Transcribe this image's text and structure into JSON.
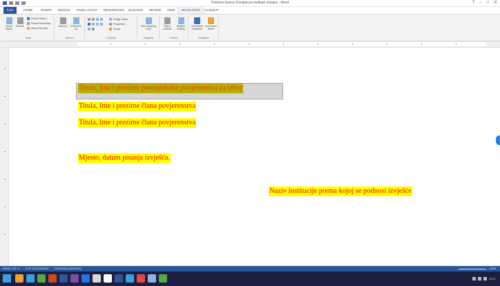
{
  "window": {
    "title": "Podnosi Surina Templat po molbani selspra - Word",
    "controls": [
      "?",
      "–",
      "□",
      "✕"
    ]
  },
  "tabs": [
    {
      "label": "FILE"
    },
    {
      "label": "HOME"
    },
    {
      "label": "INSERT"
    },
    {
      "label": "DESIGN"
    },
    {
      "label": "PAGE LAYOUT"
    },
    {
      "label": "REFERENCES"
    },
    {
      "label": "MAILINGS"
    },
    {
      "label": "REVIEW"
    },
    {
      "label": "VIEW"
    },
    {
      "label": "DEVELOPER"
    },
    {
      "label": "Acrobat Pl"
    }
  ],
  "ribbon": {
    "code": {
      "label": "Code",
      "visual_basic": "Visual Basic",
      "macros": "Macros",
      "record_macro": "Record Macro",
      "pause_recording": "Pause Recording",
      "macro_security": "Macro Security"
    },
    "addins": {
      "label": "Add-Ins",
      "add_ins": "Add-Ins",
      "com_add_ins": "COM Add-Ins"
    },
    "controls": {
      "label": "Controls",
      "design_mode": "Design Mode",
      "properties": "Properties",
      "group": "Group"
    },
    "mapping": {
      "label": "Mapping",
      "xml_mapping": "XML Mapping Pane"
    },
    "protect": {
      "label": "Protect",
      "block_authors": "Block Authors",
      "restrict_editing": "Restrict Editing"
    },
    "templates": {
      "label": "Templates",
      "document_template": "Document Template",
      "document_panel": "Document Panel"
    }
  },
  "document": {
    "lines": [
      "Titula, Ime i prezime predsjednika povjerenstva za izbor",
      "Titula, Ime i prezime člana povjerenstva",
      "Titula, Ime i prezime člana povjerenstva",
      "Mjesto, datum pisanja izvješća.",
      "Naziv institucije prema kojoj se podnosi izvješće"
    ]
  },
  "statusbar": {
    "page": "PAGE 1 OF 11",
    "words": "4 OF 1705 WORDS",
    "language": "CROATIAN (CROATIA)",
    "zoom": "100%"
  },
  "taskbar": {
    "time": "12:07"
  },
  "colors": {
    "accent": "#2b579a",
    "highlight": "#ffff00",
    "text_red": "#ff0000",
    "taskbar": "#1c1f3f"
  }
}
